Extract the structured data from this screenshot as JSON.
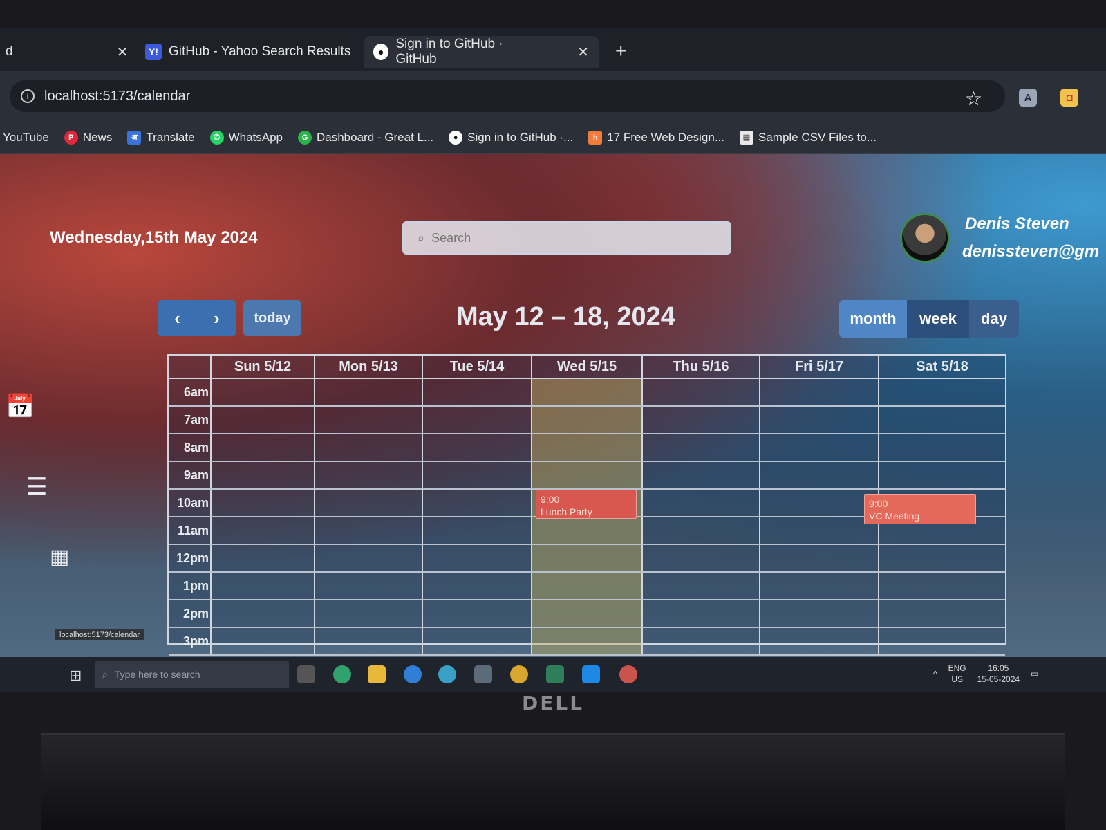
{
  "browser": {
    "tabs": [
      {
        "label": "d",
        "close": "✕"
      },
      {
        "label": "GitHub - Yahoo Search Results",
        "close": "✕"
      },
      {
        "label": "Sign in to GitHub · GitHub",
        "close": "✕"
      }
    ],
    "new_tab": "+",
    "url": "localhost:5173/calendar",
    "bookmarks": [
      {
        "label": "YouTube",
        "icon": "youtube-icon",
        "color": ""
      },
      {
        "label": "News",
        "icon": "pinterest-icon",
        "color": "#e0283a"
      },
      {
        "label": "Translate",
        "icon": "translate-icon",
        "color": "#3b73d8"
      },
      {
        "label": "WhatsApp",
        "icon": "whatsapp-icon",
        "color": "#25d366"
      },
      {
        "label": "Dashboard - Great L...",
        "icon": "great-learning-icon",
        "color": "#2bb34a"
      },
      {
        "label": "Sign in to GitHub ·...",
        "icon": "github-icon",
        "color": "#ffffff"
      },
      {
        "label": "17 Free Web Design...",
        "icon": "hubspot-icon",
        "color": "#f07b3b"
      },
      {
        "label": "Sample CSV Files to...",
        "icon": "file-icon",
        "color": "#e8e8e8"
      }
    ]
  },
  "header": {
    "date": "Wednesday,15th May 2024",
    "search_placeholder": "Search",
    "user_name": "Denis Steven",
    "user_email": "denissteven@gm"
  },
  "toolbar": {
    "prev": "‹",
    "next": "›",
    "today": "today",
    "title": "May 12 – 18, 2024",
    "views": [
      "month",
      "week",
      "day"
    ],
    "active_view": "week"
  },
  "calendar": {
    "days": [
      "Sun 5/12",
      "Mon 5/13",
      "Tue 5/14",
      "Wed 5/15",
      "Thu 5/16",
      "Fri 5/17",
      "Sat 5/18"
    ],
    "today_index": 3,
    "times": [
      "6am",
      "7am",
      "8am",
      "9am",
      "10am",
      "11am",
      "12pm",
      "1pm",
      "2pm",
      "3pm"
    ],
    "events": [
      {
        "time": "9:00",
        "title": "Lunch Party"
      },
      {
        "time": "9:00",
        "title": "VC Meeting"
      }
    ]
  },
  "status_url": "localhost:5173/calendar",
  "taskbar": {
    "search_placeholder": "Type here to search",
    "lang": "ENG",
    "region": "US",
    "time": "16:05",
    "date": "15-05-2024"
  },
  "device_brand": "DELL"
}
